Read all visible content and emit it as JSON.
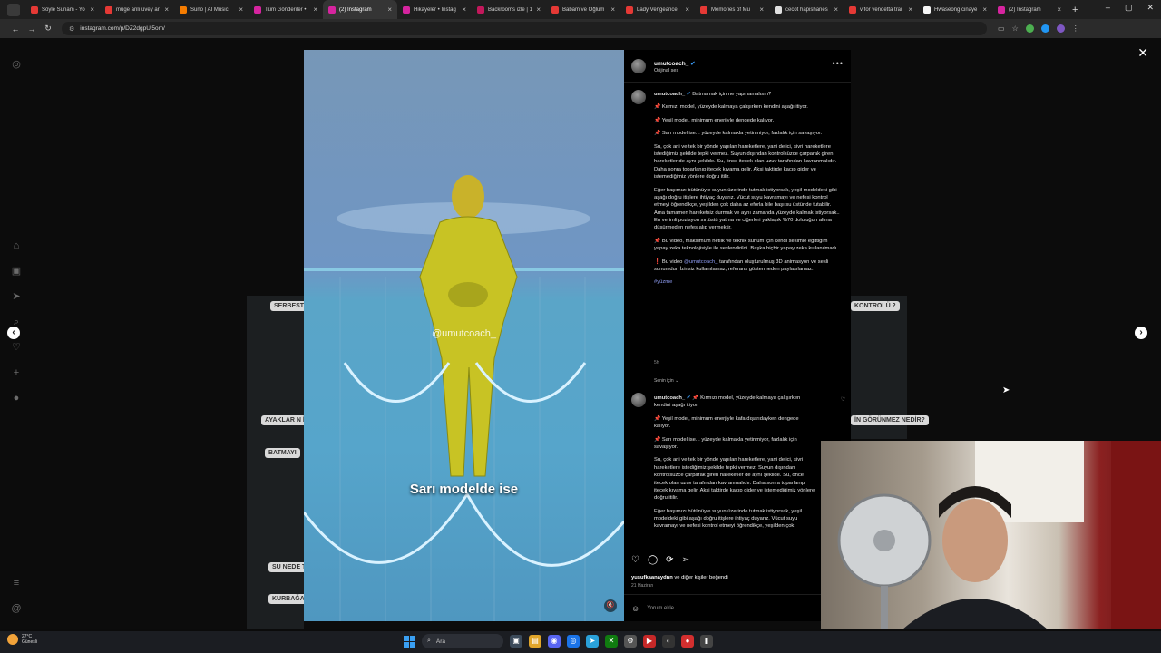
{
  "browser": {
    "tabs": [
      {
        "label": "Söyle Sunam - Yo",
        "color": "#e53935",
        "active": false
      },
      {
        "label": "müge anlı üvey ar",
        "color": "#e53935",
        "active": false
      },
      {
        "label": "Suno | AI Music",
        "color": "#f57c00",
        "active": false
      },
      {
        "label": "Tüm Gönderiler •",
        "color": "#d6249f",
        "active": false
      },
      {
        "label": "(2) Instagram",
        "color": "#d6249f",
        "active": true
      },
      {
        "label": "Hikayeler • Instag",
        "color": "#d6249f",
        "active": false
      },
      {
        "label": "Backrooms izle | 1",
        "color": "#c2185b",
        "active": false
      },
      {
        "label": "Babam ve Oğlum",
        "color": "#e53935",
        "active": false
      },
      {
        "label": "Lady Vengeance",
        "color": "#e53935",
        "active": false
      },
      {
        "label": "Memories of Mu",
        "color": "#e53935",
        "active": false
      },
      {
        "label": "cecot hapishanes",
        "color": "#e0e0e0",
        "active": false
      },
      {
        "label": "v for vendetta trai",
        "color": "#e53935",
        "active": false
      },
      {
        "label": "Hwaseong cinaye",
        "color": "#f5f5f5",
        "active": false
      },
      {
        "label": "(2) Instagram",
        "color": "#d6249f",
        "active": false
      }
    ],
    "url": "instagram.com/p/DZ2dgpUl5om/"
  },
  "post": {
    "author": "umutcoach_",
    "audio": "Orijinal ses",
    "video_watermark": "@umutcoach_",
    "video_subtitle": "Sarı modelde ise",
    "caption_first": "Batmamak için ne yapmamalısın?",
    "caption_paragraphs": [
      "📌 Kırmızı model, yüzeyde kalmaya çalışırken kendini aşağı itiyor.",
      "📌 Yeşil model, minimum enerjiyle dengede kalıyor.",
      "📌 Sarı model ise... yüzeyde kalmakla yetinmiyor, fazlalık için savaşıyor.",
      "Su, çok ani ve tek bir yönde yapılan hareketlere, yani delici, sivri hareketlere istediğimiz şekilde tepki vermez. Suyun dışından kontrolsüzce çarparak giren hareketler de aynı şekilde. Su, önce itecek olan uzuv tarafından kavranmalıdır. Daha sonra toparlanıp itecek kıvama gelir. Aksi taktirde kaçıp gider ve istemediğimiz yönlere doğru itilir.",
      "Eğer başımızı bütünüyle suyun üzerinde tutmak istiyorsak, yeşil modeldeki gibi aşağı doğru itişlere ihtiyaç duyarız. Vücut suyu kavramayı ve nefesi kontrol etmeyi öğrendikçe, yeşilden çok daha az eforla bile başı su üstünde tutabilir. Ama tamamen hareketsiz durmak ve aynı zamanda yüzeyde kalmak istiyorsak.. En verimli pozisyon sırtüstü yatma ve ciğerleri yaklaşık %70 doluluğun altına düşürmeden nefes alıp vermektir.",
      "📌 Bu video, maksimum netlik ve teknik sunum için kendi sesimle eğittiğim yapay zeka teknolojisiyle ile seslendirildi. Başka hiçbir yapay zeka kullanılmadı."
    ],
    "credit_prefix": "❗ Bu video",
    "credit_mention": "@umutcoach_",
    "credit_suffix": "tarafından oluşturulmuş 3D animasyon ve sesli sunumdur. İzinsiz kullanılamaz, referans göstermeden paylaşılamaz.",
    "hashtag": "#yüzme",
    "time_ago": "5h",
    "for_you": "Senin için ⌄",
    "comment": {
      "author": "umutcoach_",
      "first_line": "📌 Kırmızı model, yüzeyde kalmaya çalışırken kendini aşağı itiyor.",
      "paragraphs": [
        "📌 Yeşil model, minimum enerjiyle kafa dışarıdayken dengede kalıyor.",
        "📌 Sarı model ise... yüzeyde kalmakla yetinmiyor, fazlalık için savaşıyor.",
        "Su, çok ani ve tek bir yönde yapılan hareketlere, yani delici, sivri hareketlere istediğimiz şekilde tepki vermez. Suyun dışından kontrolsüzce çarparak giren hareketler de aynı şekilde. Su, önce itecek olan uzuv tarafından kavranmalıdır. Daha sonra toparlanıp itecek kıvama gelir. Aksi taktirde kaçıp gider ve istemediğimiz yönlere doğru itilir.",
        "Eğer başımızı bütünüyle suyun üzerinde tutmak istiyorsak, yeşil modeldeki gibi aşağı doğru itişlere ihtiyaç duyarız. Vücut suyu kavramayı ve nefesi kontrol etmeyi öğrendikçe, yeşilden çok"
      ]
    },
    "likes_user": "yusufkaanaydnn",
    "likes_suffix": "ve diğer kişiler beğendi",
    "date": "21 Haziran",
    "comment_placeholder": "Yorum ekle..."
  },
  "background_labels": [
    "SERBEST",
    "AYAKLAR N İŞE YAR",
    "BATMAYI",
    "SU NEDE TAŞIYAB",
    "KURBAĞA",
    "KONTROLÜ 2",
    "İN GÖRÜNMEZ NEDİR?"
  ],
  "taskbar": {
    "weather_temp": "27°C",
    "weather_desc": "Güneşli",
    "search_label": "Ara"
  }
}
